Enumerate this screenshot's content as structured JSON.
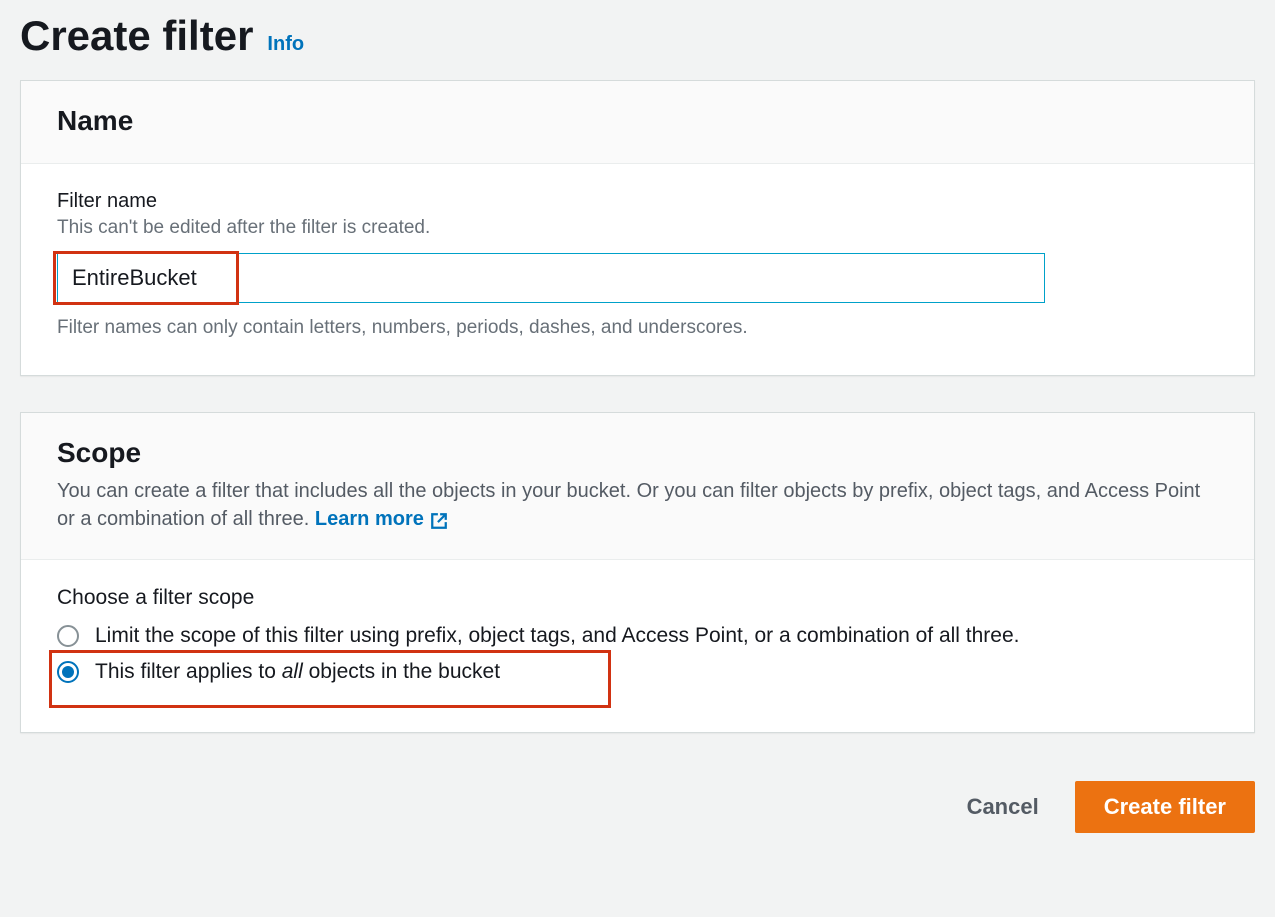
{
  "header": {
    "title": "Create filter",
    "info_label": "Info"
  },
  "name_panel": {
    "heading": "Name",
    "field_label": "Filter name",
    "field_hint": "This can't be edited after the filter is created.",
    "input_value": "EntireBucket",
    "constraint": "Filter names can only contain letters, numbers, periods, dashes, and underscores."
  },
  "scope_panel": {
    "heading": "Scope",
    "description": "You can create a filter that includes all the objects in your bucket. Or you can filter objects by prefix, object tags, and Access Point or a combination of all three. ",
    "learn_more_label": "Learn more",
    "choose_label": "Choose a filter scope",
    "option_limit": "Limit the scope of this filter using prefix, object tags, and Access Point, or a combination of all three.",
    "option_all_pre": "This filter applies to ",
    "option_all_ital": "all",
    "option_all_post": " objects in the bucket"
  },
  "footer": {
    "cancel_label": "Cancel",
    "create_label": "Create filter"
  }
}
